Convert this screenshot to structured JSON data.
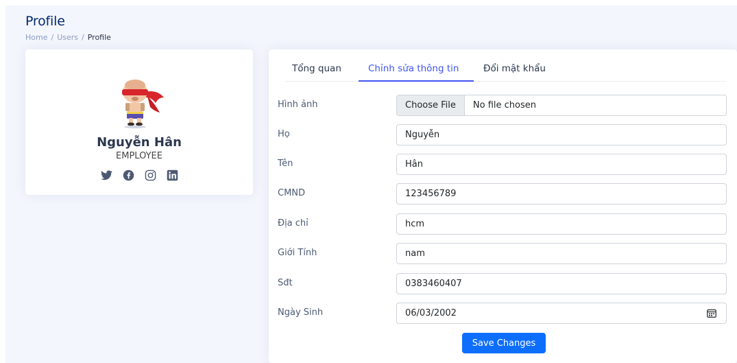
{
  "header": {
    "title": "Profile",
    "breadcrumb": [
      "Home",
      "Users",
      "Profile"
    ],
    "breadcrumb_sep": "/"
  },
  "profile": {
    "name": "Nguyễn Hân",
    "role": "EMPLOYEE",
    "social_icons": [
      "twitter-icon",
      "facebook-icon",
      "instagram-icon",
      "linkedin-icon"
    ]
  },
  "tabs": [
    {
      "label": "Tổng quan",
      "active": false
    },
    {
      "label": "Chỉnh sửa thông tin",
      "active": true
    },
    {
      "label": "Đổi mật khẩu",
      "active": false
    }
  ],
  "form": {
    "image": {
      "label": "Hình ảnh",
      "button": "Choose File",
      "status": "No file chosen"
    },
    "ho": {
      "label": "Họ",
      "value": "Nguyễn"
    },
    "ten": {
      "label": "Tên",
      "value": "Hân"
    },
    "cmnd": {
      "label": "CMND",
      "value": "123456789"
    },
    "diachi": {
      "label": "Địa chỉ",
      "value": "hcm"
    },
    "gioitinh": {
      "label": "Giới Tính",
      "value": "nam"
    },
    "sdt": {
      "label": "Sđt",
      "value": "0383460407"
    },
    "ngaysinh": {
      "label": "Ngày Sinh",
      "value": "06/03/2002"
    },
    "save_label": "Save Changes"
  },
  "colors": {
    "accent": "#4154f1",
    "primary_button": "#0d6efd",
    "title": "#012970",
    "background": "#f4f6fd"
  }
}
